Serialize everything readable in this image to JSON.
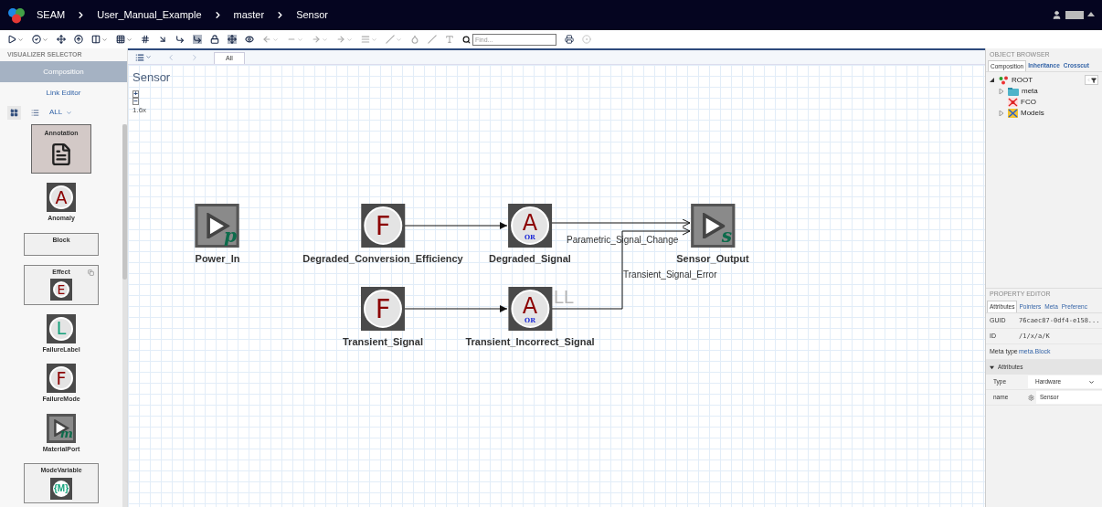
{
  "breadcrumb": [
    "SEAM",
    "User_Manual_Example",
    "master",
    "Sensor"
  ],
  "toolbar": {
    "find_placeholder": "Find..."
  },
  "visualizer_selector": {
    "title": "VISUALIZER SELECTOR",
    "tabs": [
      {
        "label": "Composition",
        "selected": true
      },
      {
        "label": "Link Editor",
        "selected": false
      }
    ],
    "views": [
      {
        "kind": "grid",
        "selected": true
      },
      {
        "kind": "list",
        "selected": false
      }
    ],
    "filter": "ALL",
    "items": [
      {
        "label": "Annotation",
        "kind": "annotation",
        "selected": true
      },
      {
        "label": "Anomaly",
        "kind": "icon",
        "glyph": "A",
        "selected": false
      },
      {
        "label": "Block",
        "kind": "block",
        "selected": false
      },
      {
        "label": "Effect",
        "kind": "framed",
        "glyph": "E",
        "selected": false
      },
      {
        "label": "FailureLabel",
        "kind": "icon",
        "glyph": "L",
        "selected": false
      },
      {
        "label": "FailureMode",
        "kind": "icon",
        "glyph": "F",
        "selected": false
      },
      {
        "label": "MaterialPort",
        "kind": "port",
        "glyph": "m",
        "selected": false
      },
      {
        "label": "ModeVariable",
        "kind": "framed",
        "glyph": "{M}",
        "selected": false
      }
    ]
  },
  "canvas": {
    "tabs": [
      {
        "label": "All",
        "selected": true
      }
    ],
    "title": "Sensor",
    "zoom_in": "+",
    "zoom_out": "−",
    "zoom": "1.6x",
    "faint_text": "LL",
    "nodes": [
      {
        "label": "Power_In",
        "kind": "port",
        "glyph": "p"
      },
      {
        "label": "Degraded_Conversion_Efficiency",
        "kind": "failure",
        "glyph": "F"
      },
      {
        "label": "Degraded_Signal",
        "kind": "anomaly",
        "glyph": "A",
        "sub": "OR"
      },
      {
        "label": "Sensor_Output",
        "kind": "port",
        "glyph": "s"
      },
      {
        "label": "Transient_Signal",
        "kind": "failure",
        "glyph": "F"
      },
      {
        "label": "Transient_Incorrect_Signal",
        "kind": "anomaly",
        "glyph": "A",
        "sub": "OR"
      }
    ],
    "connection_labels": [
      "Parametric_Signal_Change",
      "Transient_Signal_Error"
    ]
  },
  "object_browser": {
    "title": "OBJECT BROWSER",
    "tabs": [
      {
        "label": "Composition",
        "selected": true
      },
      {
        "label": "Inheritance",
        "selected": false
      },
      {
        "label": "Crosscut",
        "selected": false
      }
    ],
    "tree": [
      {
        "label": "ROOT",
        "kind": "root",
        "expanded": true,
        "children": [
          {
            "label": "meta",
            "kind": "folder",
            "expanded": false
          },
          {
            "label": "FCO",
            "kind": "fco"
          },
          {
            "label": "Models",
            "kind": "models",
            "expanded": false
          }
        ]
      }
    ]
  },
  "property_editor": {
    "title": "PROPERTY EDITOR",
    "tabs": [
      {
        "label": "Attributes",
        "selected": true
      },
      {
        "label": "Pointers",
        "selected": false
      },
      {
        "label": "Meta",
        "selected": false
      },
      {
        "label": "Preferenc",
        "selected": false
      }
    ],
    "rows": [
      {
        "name": "GUID",
        "value": "76caec87-0df4-e158..."
      },
      {
        "name": "ID",
        "value": "/1/x/a/K"
      },
      {
        "name": "Meta type",
        "value": "meta.Block",
        "kind": "link"
      }
    ],
    "section": {
      "label": "Attributes",
      "expanded": true
    },
    "attributes": [
      {
        "name": "Type",
        "value": "Hardware",
        "kind": "select"
      },
      {
        "name": "name",
        "value": "Sensor",
        "kind": "text"
      }
    ]
  }
}
